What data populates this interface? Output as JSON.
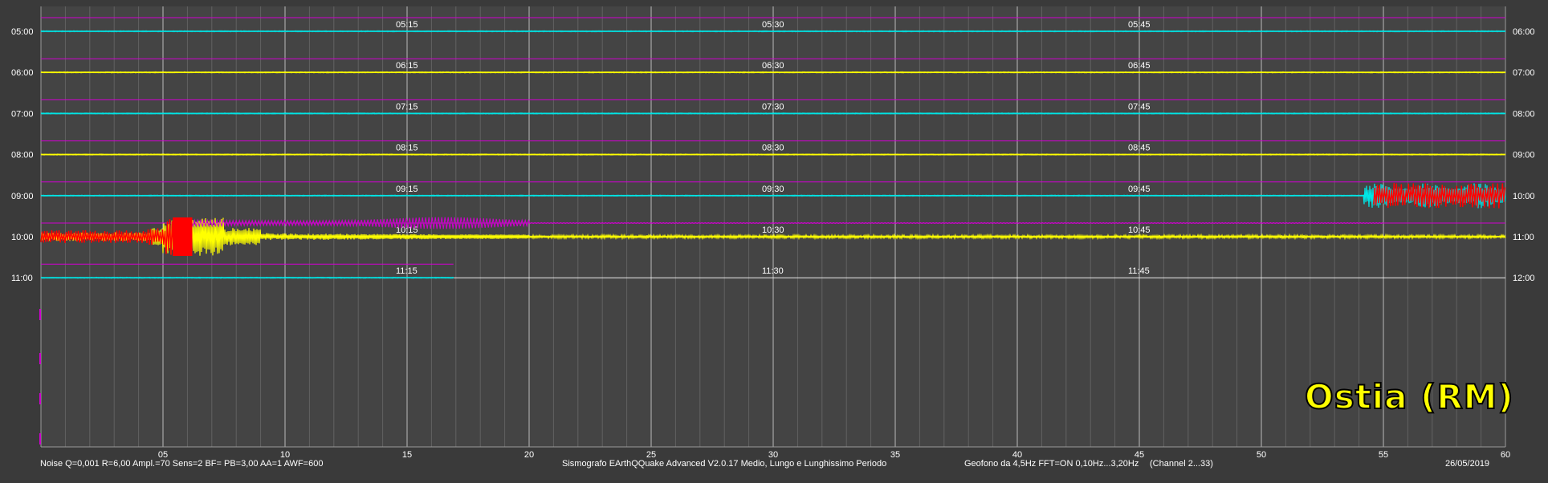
{
  "colors": {
    "background": "#3a3a3a",
    "plot_background": "#444444",
    "grid_major": "#cfcfcf",
    "grid_minor": "#6a6a6a",
    "trace_cyan": "#00e5e5",
    "trace_yellow": "#ffff00",
    "trace_magenta": "#d000d0",
    "trigger_red": "#ff0000",
    "text": "#ffffff",
    "station": "#ffff00"
  },
  "footer": {
    "settings": "Noise Q=0,001 R=6,00 Ampl.=70 Sens=2 BF= PB=3,00 AA=1 AWF=600",
    "software": "Sismografo  EArthQQuake Advanced V2.0.17  Medio, Lungo e Lunghissimo Periodo",
    "sensor": "Geofono da 4,5Hz FFT=ON 0,10Hz...3,20Hz",
    "channel": "(Channel 2...33)",
    "date": "26/05/2019"
  },
  "station": "Ostia (RM)",
  "chart_data": {
    "type": "line",
    "x_axis": {
      "range": [
        0,
        60
      ],
      "unit": "minutes",
      "ticks": [
        "05",
        "10",
        "15",
        "20",
        "25",
        "30",
        "35",
        "40",
        "45",
        "50",
        "55",
        "60"
      ]
    },
    "rows": [
      {
        "left_label": "05:00",
        "right_label": "06:00",
        "quarter_labels": [
          "05:15",
          "05:30",
          "05:45"
        ],
        "color": "trace_cyan",
        "data_until": 60,
        "activity": "quiet"
      },
      {
        "left_label": "06:00",
        "right_label": "07:00",
        "quarter_labels": [
          "06:15",
          "06:30",
          "06:45"
        ],
        "color": "trace_yellow",
        "data_until": 60,
        "activity": "quiet"
      },
      {
        "left_label": "07:00",
        "right_label": "08:00",
        "quarter_labels": [
          "07:15",
          "07:30",
          "07:45"
        ],
        "color": "trace_cyan",
        "data_until": 60,
        "activity": "quiet"
      },
      {
        "left_label": "08:00",
        "right_label": "09:00",
        "quarter_labels": [
          "08:15",
          "08:30",
          "08:45"
        ],
        "color": "trace_yellow",
        "data_until": 60,
        "activity": "quiet"
      },
      {
        "left_label": "09:00",
        "right_label": "10:00",
        "quarter_labels": [
          "09:15",
          "09:30",
          "09:45"
        ],
        "color": "trace_cyan",
        "data_until": 60,
        "activity": "event_onset",
        "event_start": 54.2,
        "trigger_red": true
      },
      {
        "left_label": "10:00",
        "right_label": "11:00",
        "quarter_labels": [
          "10:15",
          "10:30",
          "10:45"
        ],
        "color": "trace_yellow",
        "data_until": 60,
        "activity": "event_coda",
        "peak_minute": 6,
        "trigger_red_until": 6.2
      },
      {
        "left_label": "11:00",
        "right_label": "12:00",
        "quarter_labels": [
          "11:15",
          "11:30",
          "11:45"
        ],
        "color": "trace_cyan",
        "data_until": 16.9,
        "activity": "quiet"
      }
    ]
  }
}
